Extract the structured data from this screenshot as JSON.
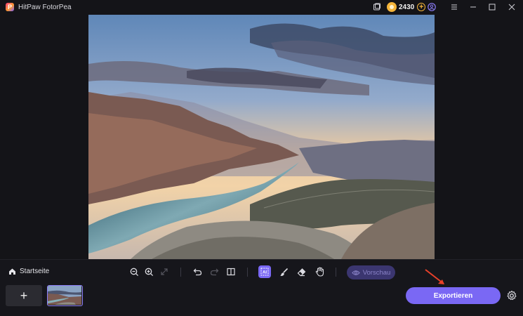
{
  "app": {
    "title": "HitPaw FotorPea",
    "logo_letter": "P"
  },
  "titlebar": {
    "coins": "2430",
    "add_coins": "+",
    "icons": [
      "message-icon",
      "coin-icon",
      "add-coin-icon",
      "user-icon",
      "menu-icon",
      "minimize-icon",
      "maximize-icon",
      "close-icon"
    ]
  },
  "toolbar": {
    "home_label": "Startseite",
    "ai_label": "AI",
    "preview_label": "Vorschau",
    "tools": [
      "zoom-out-icon",
      "zoom-in-icon",
      "fit-screen-icon",
      "undo-icon",
      "redo-icon",
      "compare-icon",
      "ai-select-icon",
      "brush-icon",
      "eraser-icon",
      "hand-icon",
      "eye-icon"
    ]
  },
  "strip": {
    "add_label": "+",
    "export_label": "Exportieren"
  },
  "colors": {
    "accent": "#7a68f4",
    "background": "#141418",
    "coin": "#f4b43a",
    "annotation_arrow": "#e8402a"
  }
}
